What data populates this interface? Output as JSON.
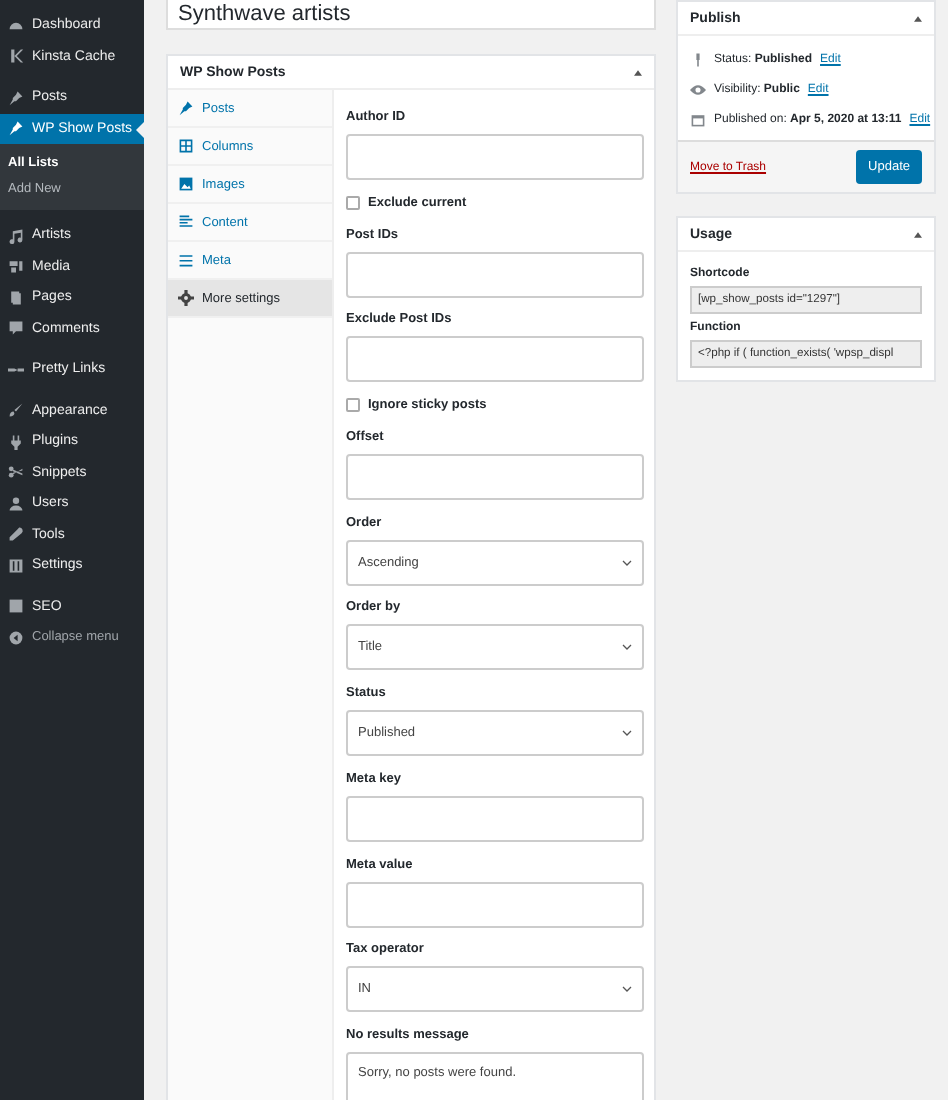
{
  "sidebar": {
    "items": [
      {
        "label": "Dashboard",
        "kind": "menu",
        "selected": false
      },
      {
        "label": "Kinsta Cache",
        "kind": "menu",
        "selected": false
      },
      {
        "label": "Posts",
        "kind": "menu",
        "selected": false
      },
      {
        "label": "WP Show Posts",
        "kind": "menu",
        "selected": true,
        "children": [
          {
            "label": "All Lists",
            "selected": true
          },
          {
            "label": "Add New",
            "selected": false
          }
        ]
      },
      {
        "label": "Artists",
        "kind": "menu",
        "selected": false
      },
      {
        "label": "Media",
        "kind": "menu",
        "selected": false
      },
      {
        "label": "Pages",
        "kind": "menu",
        "selected": false
      },
      {
        "label": "Comments",
        "kind": "menu",
        "selected": false
      },
      {
        "label": "Pretty Links",
        "kind": "menu",
        "selected": false
      },
      {
        "label": "Appearance",
        "kind": "menu",
        "selected": false
      },
      {
        "label": "Plugins",
        "kind": "menu",
        "selected": false
      },
      {
        "label": "Snippets",
        "kind": "menu",
        "selected": false
      },
      {
        "label": "Users",
        "kind": "menu",
        "selected": false
      },
      {
        "label": "Tools",
        "kind": "menu",
        "selected": false
      },
      {
        "label": "Settings",
        "kind": "menu",
        "selected": false
      },
      {
        "label": "SEO",
        "kind": "menu",
        "selected": false
      },
      {
        "label": "Collapse menu",
        "kind": "collapse",
        "selected": false
      }
    ]
  },
  "title_field": {
    "value": "Synthwave artists"
  },
  "metabox": {
    "title": "WP Show Posts",
    "tabs": [
      {
        "label": "Posts",
        "selected": false
      },
      {
        "label": "Columns",
        "selected": false
      },
      {
        "label": "Images",
        "selected": false
      },
      {
        "label": "Content",
        "selected": false
      },
      {
        "label": "Meta",
        "selected": false
      },
      {
        "label": "More settings",
        "selected": true
      }
    ],
    "fields": [
      {
        "kind": "text",
        "label": "Author ID"
      },
      {
        "kind": "checkbox",
        "label": "Exclude current",
        "checked": false
      },
      {
        "kind": "text",
        "label": "Post IDs"
      },
      {
        "kind": "text",
        "label": "Exclude Post IDs"
      },
      {
        "kind": "checkbox",
        "label": "Ignore sticky posts",
        "checked": false
      },
      {
        "kind": "text",
        "label": "Offset"
      },
      {
        "kind": "select",
        "label": "Order",
        "value": "Ascending"
      },
      {
        "kind": "select",
        "label": "Order by",
        "value": "Title"
      },
      {
        "kind": "select",
        "label": "Status",
        "value": "Published"
      },
      {
        "kind": "text",
        "label": "Meta key"
      },
      {
        "kind": "text",
        "label": "Meta value"
      },
      {
        "kind": "select",
        "label": "Tax operator",
        "value": "IN"
      },
      {
        "kind": "textarea",
        "label": "No results message",
        "value": "Sorry, no posts were found."
      }
    ]
  },
  "publish": {
    "title": "Publish",
    "rows": [
      {
        "text": "Status: **Published**",
        "link": "Edit"
      },
      {
        "text": "Visibility: **Public**",
        "link": "Edit"
      },
      {
        "text": "Published on: **Apr 5, 2020 at 13:11**",
        "link": "Edit"
      }
    ],
    "trash": "Move to Trash",
    "button": "Update"
  },
  "usage": {
    "title": "Usage",
    "fields": [
      {
        "label": "Shortcode",
        "value": "[wp_show_posts id=\"1297\"]"
      },
      {
        "label": "Function",
        "value": "<?php if ( function_exists( 'wpsp_displ"
      }
    ]
  }
}
